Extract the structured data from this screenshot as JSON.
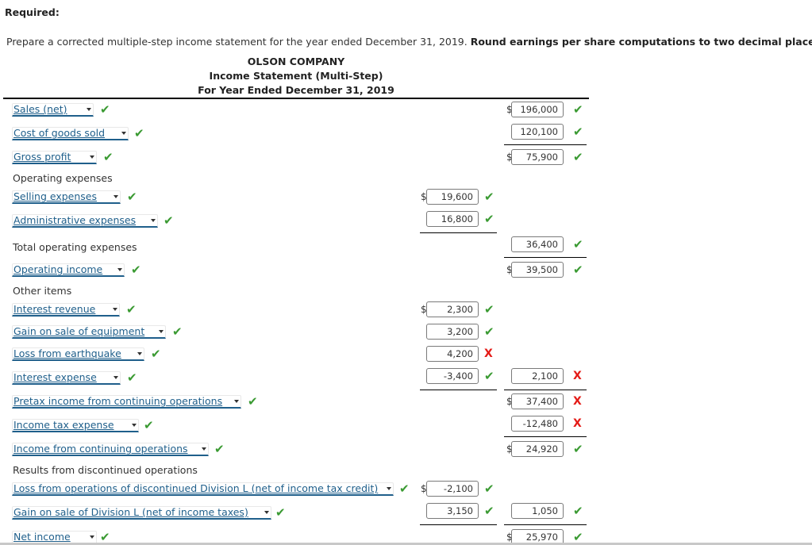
{
  "required_label": "Required:",
  "instructions": {
    "text": "Prepare a corrected multiple-step income statement for the year ended December 31, 2019. ",
    "bold": "Round earnings per share computations to two decimal places."
  },
  "statement": {
    "company": "OLSON COMPANY",
    "title": "Income Statement (Multi-Step)",
    "period": "For Year Ended December 31, 2019"
  },
  "currency_symbol": "$",
  "rows": {
    "sales": {
      "label": "Sales (net)",
      "label_status": "correct",
      "value": "196,000",
      "status": "correct"
    },
    "cogs": {
      "label": "Cost of goods sold",
      "label_status": "correct",
      "value": "120,100",
      "status": "correct"
    },
    "gross_profit": {
      "label": "Gross profit",
      "label_status": "correct",
      "value": "75,900",
      "status": "correct"
    },
    "operating_expenses_heading": {
      "label": "Operating expenses"
    },
    "selling": {
      "label": "Selling expenses",
      "label_status": "correct",
      "value": "19,600",
      "status": "correct"
    },
    "admin": {
      "label": "Administrative expenses",
      "label_status": "correct",
      "value": "16,800",
      "status": "correct"
    },
    "total_opex": {
      "label": "Total operating expenses",
      "value": "36,400",
      "status": "correct"
    },
    "operating_income": {
      "label": "Operating income",
      "label_status": "correct",
      "value": "39,500",
      "status": "correct"
    },
    "other_items_heading": {
      "label": "Other items"
    },
    "interest_revenue": {
      "label": "Interest revenue",
      "label_status": "correct",
      "value": "2,300",
      "status": "correct"
    },
    "gain_equipment": {
      "label": "Gain on sale of equipment",
      "label_status": "correct",
      "value": "3,200",
      "status": "correct"
    },
    "loss_earthquake": {
      "label": "Loss from earthquake",
      "label_status": "correct",
      "value": "4,200",
      "status": "incorrect"
    },
    "interest_expense": {
      "label": "Interest expense",
      "label_status": "correct",
      "value": "-3,400",
      "status": "correct",
      "total_value": "2,100",
      "total_status": "incorrect"
    },
    "pretax_income": {
      "label": "Pretax income from continuing operations",
      "label_status": "correct",
      "value": "37,400",
      "status": "incorrect"
    },
    "income_tax": {
      "label": "Income tax expense",
      "label_status": "correct",
      "value": "-12,480",
      "status": "incorrect"
    },
    "income_continuing": {
      "label": "Income from continuing operations",
      "label_status": "correct",
      "value": "24,920",
      "status": "correct"
    },
    "discontinued_heading": {
      "label": "Results from discontinued operations"
    },
    "loss_division": {
      "label": "Loss from operations of discontinued Division L (net of income tax credit)",
      "label_status": "correct",
      "value": "-2,100",
      "status": "correct"
    },
    "gain_division": {
      "label": "Gain on sale of Division L (net of income taxes)",
      "label_status": "correct",
      "value": "3,150",
      "status": "correct",
      "total_value": "1,050",
      "total_status": "correct"
    },
    "net_income": {
      "label": "Net income",
      "label_status": "correct",
      "value": "25,970",
      "status": "correct"
    }
  },
  "icons": {
    "correct": "✔",
    "incorrect": "X"
  },
  "colors": {
    "correct": "#3a9a32",
    "incorrect": "#e41b17",
    "select_text": "#1f5f8b"
  }
}
